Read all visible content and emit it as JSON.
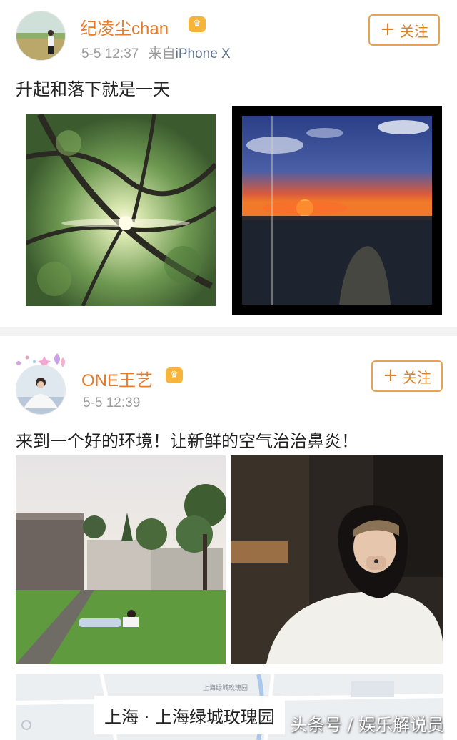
{
  "feed": {
    "posts": [
      {
        "username": "纪凌尘chan",
        "vip_badge": "V",
        "timestamp": "5-5 12:37",
        "source_prefix": "来自",
        "source_device": "iPhone X",
        "follow_label": "关注",
        "text": "升起和落下就是一天",
        "images": [
          "tree-sunlight-photo",
          "sunset-photo"
        ]
      },
      {
        "username": "ONE王艺",
        "vip_badge": "V",
        "timestamp": "5-5 12:39",
        "follow_label": "关注",
        "text": "来到一个好的环境！让新鲜的空气治治鼻炎！",
        "images": [
          "lawn-photo",
          "portrait-photo"
        ],
        "location": "上海 · 上海绿城玫瑰园",
        "map_label": "上海绿城玫瑰园"
      }
    ]
  },
  "watermark": "头条号 / 娱乐解说员",
  "colors": {
    "username": "#e77c2c",
    "follow_border": "#e7a354",
    "meta_gray": "#9a9a9a",
    "divider": "#f2f2f2"
  },
  "icons": {
    "follow": "plus-icon",
    "vip": "crown-badge-icon"
  }
}
